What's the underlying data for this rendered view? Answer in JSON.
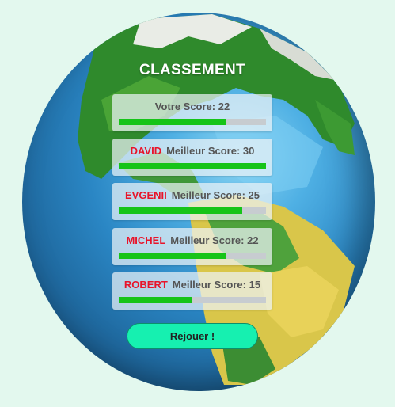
{
  "title": "CLASSEMENT",
  "your_score": {
    "label": "Votre Score: 22",
    "progress": 0.73
  },
  "leaderboard": [
    {
      "name": "DAVID",
      "score_label": "Meilleur Score: 30",
      "progress": 1.0
    },
    {
      "name": "EVGENII",
      "score_label": "Meilleur Score: 25",
      "progress": 0.84
    },
    {
      "name": "MICHEL",
      "score_label": "Meilleur Score: 22",
      "progress": 0.73
    },
    {
      "name": "ROBERT",
      "score_label": "Meilleur Score: 15",
      "progress": 0.5
    }
  ],
  "replay_label": "Rejouer !",
  "colors": {
    "background": "#e3f8ee",
    "name": "#e8142a",
    "bar_fill": "#16c418",
    "bar_track": "#c7ccd0",
    "button": "#16f0b0"
  }
}
